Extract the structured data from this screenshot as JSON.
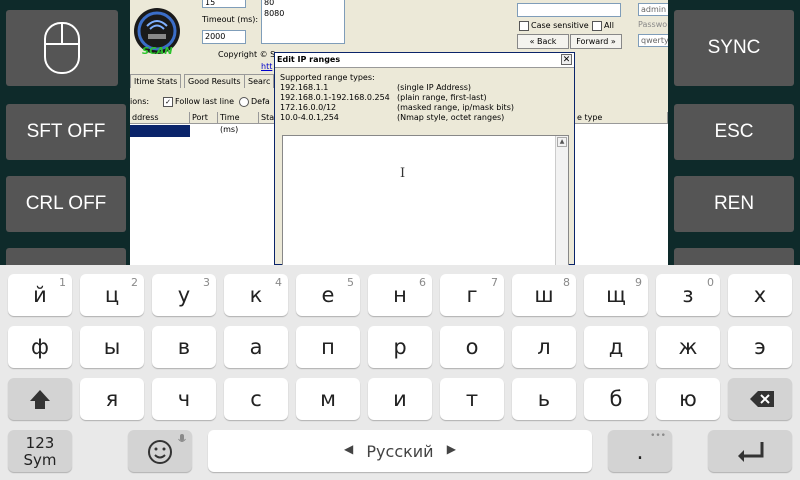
{
  "side_buttons": {
    "sync": "SYNC",
    "sft": "SFT OFF",
    "esc": "ESC",
    "crl": "CRL OFF",
    "ren": "REN"
  },
  "app": {
    "logo_text": "SCAN",
    "threads_value": "15",
    "ports_values": [
      "80",
      "8080"
    ],
    "timeout_label": "Timeout (ms):",
    "timeout_value": "2000",
    "copyright": "Copyright © S",
    "link_fragment": "htt",
    "case_sensitive_label": "Case sensitive",
    "all_label": "All",
    "back_label": "« Back",
    "forward_label": "Forward »",
    "user_value": "admin",
    "password_label": "Passwo",
    "password_value": "qwerty",
    "tabs": [
      "ltime Stats",
      "Good Results",
      "Searc"
    ],
    "options_label": "ions:",
    "follow_last_line_label": "Follow last line",
    "default_label": "Defa",
    "columns": [
      "ddress",
      "Port",
      "Time (ms)",
      "Sta"
    ],
    "right_column": "e type"
  },
  "dialog": {
    "title": "Edit IP ranges",
    "close_glyph": "✕",
    "supported_label": "Supported range types:",
    "ranges": [
      {
        "example": "192.168.1.1",
        "desc": "(single IP Address)"
      },
      {
        "example": "192.168.0.1-192.168.0.254",
        "desc": "(plain range, first-last)"
      },
      {
        "example": "172.16.0.0/12",
        "desc": "(masked range, ip/mask bits)"
      },
      {
        "example": "10.0-4.0.1,254",
        "desc": "(Nmap style, octet ranges)"
      }
    ],
    "text_cursor_glyph": "I"
  },
  "keyboard": {
    "row1": [
      {
        "char": "й",
        "sup": "1"
      },
      {
        "char": "ц",
        "sup": "2"
      },
      {
        "char": "у",
        "sup": "3"
      },
      {
        "char": "к",
        "sup": "4"
      },
      {
        "char": "е",
        "sup": "5"
      },
      {
        "char": "н",
        "sup": "6"
      },
      {
        "char": "г",
        "sup": "7"
      },
      {
        "char": "ш",
        "sup": "8"
      },
      {
        "char": "щ",
        "sup": "9"
      },
      {
        "char": "з",
        "sup": "0"
      },
      {
        "char": "х",
        "sup": ""
      }
    ],
    "row2": [
      "ф",
      "ы",
      "в",
      "а",
      "п",
      "р",
      "о",
      "л",
      "д",
      "ж",
      "э"
    ],
    "row3": [
      "я",
      "ч",
      "с",
      "м",
      "и",
      "т",
      "ь",
      "б",
      "ю"
    ],
    "sym_label_top": "123",
    "sym_label_bottom": "Sym",
    "space_label": "Русский",
    "period_label": ".",
    "icons": {
      "shift": "shift-arrow-icon",
      "backspace": "backspace-icon",
      "emoji": "smiley-icon",
      "mic": "microphone-icon",
      "enter": "enter-arrow-icon",
      "mouse": "mouse-icon"
    }
  }
}
